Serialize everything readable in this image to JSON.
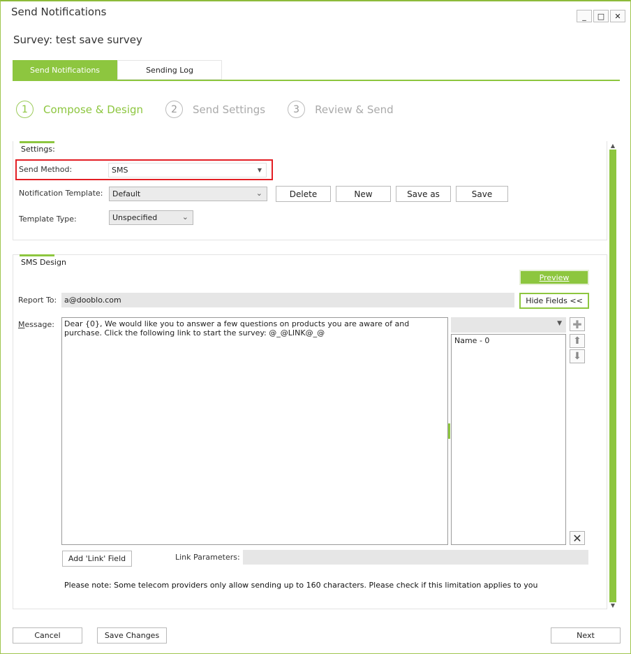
{
  "window": {
    "title": "Send Notifications",
    "controls": [
      "_",
      "□",
      "✕"
    ]
  },
  "survey": {
    "title": "Survey: test save survey"
  },
  "tabs": [
    {
      "label": "Send Notifications",
      "active": true
    },
    {
      "label": "Sending Log",
      "active": false
    }
  ],
  "steps": [
    {
      "num": "1",
      "label": "Compose & Design",
      "active": true
    },
    {
      "num": "2",
      "label": "Send Settings",
      "active": false
    },
    {
      "num": "3",
      "label": "Review & Send",
      "active": false
    }
  ],
  "settings": {
    "title": "Settings:",
    "send_method_label": "Send Method:",
    "send_method_value": "SMS",
    "template_label": "Notification Template:",
    "template_value": "Default",
    "template_type_label": "Template Type:",
    "template_type_value": "Unspecified",
    "buttons": {
      "delete": "Delete",
      "new": "New",
      "save_as": "Save as",
      "save": "Save"
    }
  },
  "sms": {
    "title": "SMS Design",
    "preview_label": "Preview",
    "hide_fields_label": "Hide Fields <<",
    "report_to_label": "Report To:",
    "report_to_value": "a@dooblo.com",
    "message_label": "Message:",
    "message_value": "Dear {0}, We would like you to answer a few questions on products you are aware of and purchase. Click the following link to start the survey: @_@LINK@_@",
    "field_dropdown_value": "",
    "field_items": [
      "Name - 0"
    ],
    "add_link_label": "Add 'Link' Field",
    "link_params_label": "Link Parameters:",
    "link_params_value": "",
    "note": "Please note: Some telecom providers only allow sending up to 160 characters. Please check if this limitation applies to you"
  },
  "footer": {
    "cancel": "Cancel",
    "save_changes": "Save Changes",
    "next": "Next"
  },
  "colors": {
    "accent": "#8dc63f",
    "highlight": "#e31e24"
  },
  "icons": {
    "add": "plus-icon",
    "up": "arrow-up-icon",
    "down": "arrow-down-icon",
    "remove": "close-icon"
  }
}
